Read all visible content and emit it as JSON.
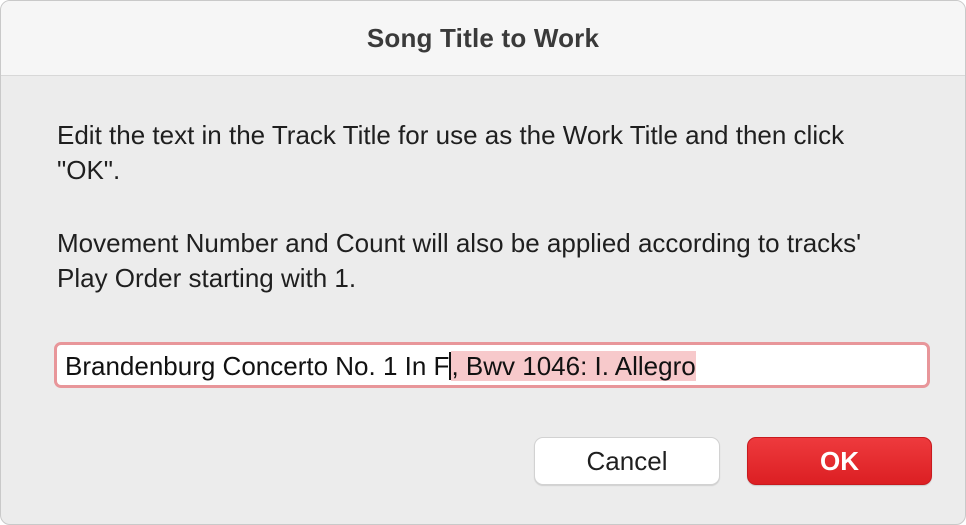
{
  "dialog": {
    "title": "Song Title to Work",
    "message1": "Edit the text in the Track Title for use as the Work Title and then click \"OK\".",
    "message2": "Movement Number and Count will also be applied according to tracks' Play Order starting with 1."
  },
  "work_title_field": {
    "value_unselected": "Brandenburg Concerto No. 1 In F",
    "value_selected": ", Bwv 1046: I. Allegro"
  },
  "buttons": {
    "cancel_label": "Cancel",
    "ok_label": "OK"
  },
  "colors": {
    "accent": "#dc1f23",
    "focus_ring": "#e8969a",
    "selection": "#f7c9cb"
  }
}
